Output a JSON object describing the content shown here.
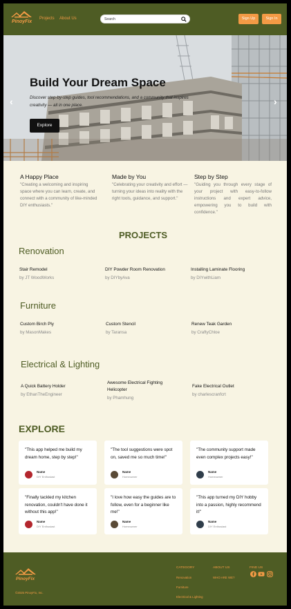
{
  "header": {
    "brand": "PinoyFix",
    "nav": [
      "Projects",
      "About Us"
    ],
    "search_placeholder": "Search",
    "signup": "Sign Up",
    "signin": "Sign In"
  },
  "hero": {
    "title": "Build Your Dream Space",
    "subtitle": "Discover step-by-step guides, tool recommendations, and a community that inspires creativity — all in one place.",
    "button": "Explore",
    "prev": "‹",
    "next": "›"
  },
  "features": [
    {
      "title": "A Happy Place",
      "text": "\"Creating a welcoming and inspiring space where you can learn, create, and connect with a community of like-minded DIY enthusiasts.\""
    },
    {
      "title": "Made by You",
      "text": "\"Celebrating your creativity and effort — turning your ideas into reality with the right tools, guidance, and support.\""
    },
    {
      "title": "Step by Step",
      "text": "\"Guiding you through every stage of your project with easy-to-follow instructions and expert advice, empowering you to build with confidence.\""
    }
  ],
  "projects_title": "PROJECTS",
  "categories": [
    {
      "title": "Renovation",
      "items": [
        {
          "name": "Stair Remodel",
          "by": "by JT WoodWorks"
        },
        {
          "name": "DIY Powder Room Renovation",
          "by": "by DIYbyAva"
        },
        {
          "name": "Installing Laminate Flooring",
          "by": "by DIYwithLiam"
        }
      ]
    },
    {
      "title": "Furniture",
      "items": [
        {
          "name": "Custom Birch Ply",
          "by": "by MasonMakes"
        },
        {
          "name": "Custom Stencil",
          "by": "by Taransa"
        },
        {
          "name": "Renew Teak Garden",
          "by": "by CraftyChloe"
        }
      ]
    },
    {
      "title": "Electrical & Lighting",
      "items": [
        {
          "name": "A Quick Battery Holder",
          "by": "by EthanTheEngineer"
        },
        {
          "name": "Awesome Electrical Fighting Helicopter",
          "by": "by Phamhung"
        },
        {
          "name": "Fake Electrical Outlet",
          "by": "by charlescranfcrt"
        }
      ]
    }
  ],
  "explore_title": "EXPLORE",
  "testimonials": [
    {
      "quote": "\"This app helped me build my dream home, step by step!\"",
      "name": "Name",
      "role": "DIY Enthusiast",
      "avatar_color": "#b3262d"
    },
    {
      "quote": "\"The tool suggestions were spot on, saved me so much time!\"",
      "name": "Name",
      "role": "Homeowner",
      "avatar_color": "#5a4a36"
    },
    {
      "quote": "\"The community support made even complex projects easy!\"",
      "name": "Name",
      "role": "Homeowner",
      "avatar_color": "#2f3d4a"
    },
    {
      "quote": "\"Finally tackled my kitchen renovation, couldn't have done it without this app!\"",
      "name": "Name",
      "role": "DIY Enthusiast",
      "avatar_color": "#b3262d"
    },
    {
      "quote": "\"I love how easy the guides are to follow, even for a beginner like me!\"",
      "name": "Name",
      "role": "Homeowner",
      "avatar_color": "#5a4a36"
    },
    {
      "quote": "\"This app turned my DIY hobby into a passion, highly recommend it!\"",
      "name": "Name",
      "role": "DIY Enthusiast",
      "avatar_color": "#2f3d4a"
    }
  ],
  "footer": {
    "brand": "PinoyFix",
    "copyright": "©2025 PinoyFix, Inc.",
    "category_head": "CATEGORY",
    "category_links": [
      "Renovation",
      "Furniture",
      "Electrical & Lighting"
    ],
    "about_head": "ABOUT US",
    "about_links": [
      "WHO ARE WE?"
    ],
    "find_head": "FIND US",
    "social": [
      "facebook-icon",
      "youtube-icon",
      "instagram-icon"
    ]
  },
  "colors": {
    "olive": "#4e5c24",
    "orange": "#f39a45",
    "cream": "#f8f4e3"
  }
}
